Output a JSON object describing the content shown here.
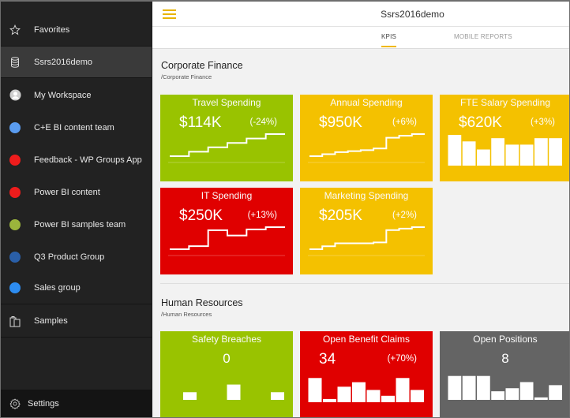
{
  "sidebar": {
    "items": [
      {
        "label": "Favorites",
        "icon": "star-icon"
      },
      {
        "label": "Ssrs2016demo",
        "icon": "database-icon",
        "active": true
      },
      {
        "label": "My Workspace",
        "icon": "user-avatar-icon"
      },
      {
        "label": "C+E BI content team",
        "icon": "group-dot-icon",
        "color": "#5a9cf0"
      },
      {
        "label": "Feedback - WP Groups App",
        "icon": "group-dot-icon",
        "color": "#ee1c1c"
      },
      {
        "label": "Power BI content",
        "icon": "group-dot-icon",
        "color": "#ee1c1c"
      },
      {
        "label": "Power BI samples team",
        "icon": "group-dot-icon",
        "color": "#9bb53c"
      },
      {
        "label": "Q3 Product Group",
        "icon": "group-dot-icon",
        "color": "#2a5fa8"
      },
      {
        "label": "Sales group",
        "icon": "group-dot-icon",
        "color": "#2d8cf0"
      },
      {
        "label": "Samples",
        "icon": "samples-icon"
      }
    ],
    "settings_label": "Settings"
  },
  "header": {
    "title": "Ssrs2016demo",
    "accent": "#f0b800"
  },
  "tabs": [
    {
      "label": "KPIS",
      "active": true
    },
    {
      "label": "MOBILE REPORTS",
      "active": false
    }
  ],
  "sections": [
    {
      "title": "Corporate Finance",
      "path": "/Corporate Finance",
      "tiles": [
        {
          "title": "Travel Spending",
          "value": "$114K",
          "change": "(-24%)",
          "color": "green",
          "chart": "step",
          "series": [
            1,
            2,
            3,
            4,
            5,
            6
          ]
        },
        {
          "title": "Annual Spending",
          "value": "$950K",
          "change": "(+6%)",
          "color": "yellow",
          "chart": "step",
          "series": [
            1,
            1.6,
            2.2,
            2.5,
            2.8,
            3.3,
            6.5,
            7.1,
            7.6
          ]
        },
        {
          "title": "FTE Salary Spending",
          "value": "$620K",
          "change": "(+3%)",
          "color": "yellow",
          "chart": "bar",
          "series": [
            9.5,
            7.5,
            5,
            8.5,
            6.5,
            6.5,
            8.5,
            8.5
          ]
        },
        {
          "title": "IT Spending",
          "value": "$250K",
          "change": "(+13%)",
          "color": "red",
          "chart": "step",
          "series": [
            1,
            1.8,
            6,
            4.6,
            6.2,
            6.8
          ]
        },
        {
          "title": "Marketing Spending",
          "value": "$205K",
          "change": "(+2%)",
          "color": "yellow",
          "chart": "step",
          "series": [
            1,
            2,
            3,
            3,
            3,
            3.3,
            7.5,
            8,
            8.5
          ]
        }
      ]
    },
    {
      "title": "Human Resources",
      "path": "/Human Resources",
      "tiles": [
        {
          "title": "Safety Breaches",
          "value": "0",
          "change": "",
          "color": "green",
          "chart": "bar",
          "series": [
            0,
            2.5,
            0,
            0,
            5,
            0,
            0,
            2.5
          ]
        },
        {
          "title": "Open Benefit Claims",
          "value": "34",
          "change": "(+70%)",
          "color": "red",
          "chart": "bar",
          "series": [
            7.5,
            1,
            4.8,
            6.2,
            3.8,
            2,
            7.5,
            3.8
          ]
        },
        {
          "title": "Open Positions",
          "value": "8",
          "change": "",
          "color": "gray",
          "chart": "bar",
          "series": [
            7.8,
            7.8,
            7.8,
            2.8,
            3.8,
            5.8,
            0.8,
            4.8
          ]
        }
      ]
    }
  ]
}
